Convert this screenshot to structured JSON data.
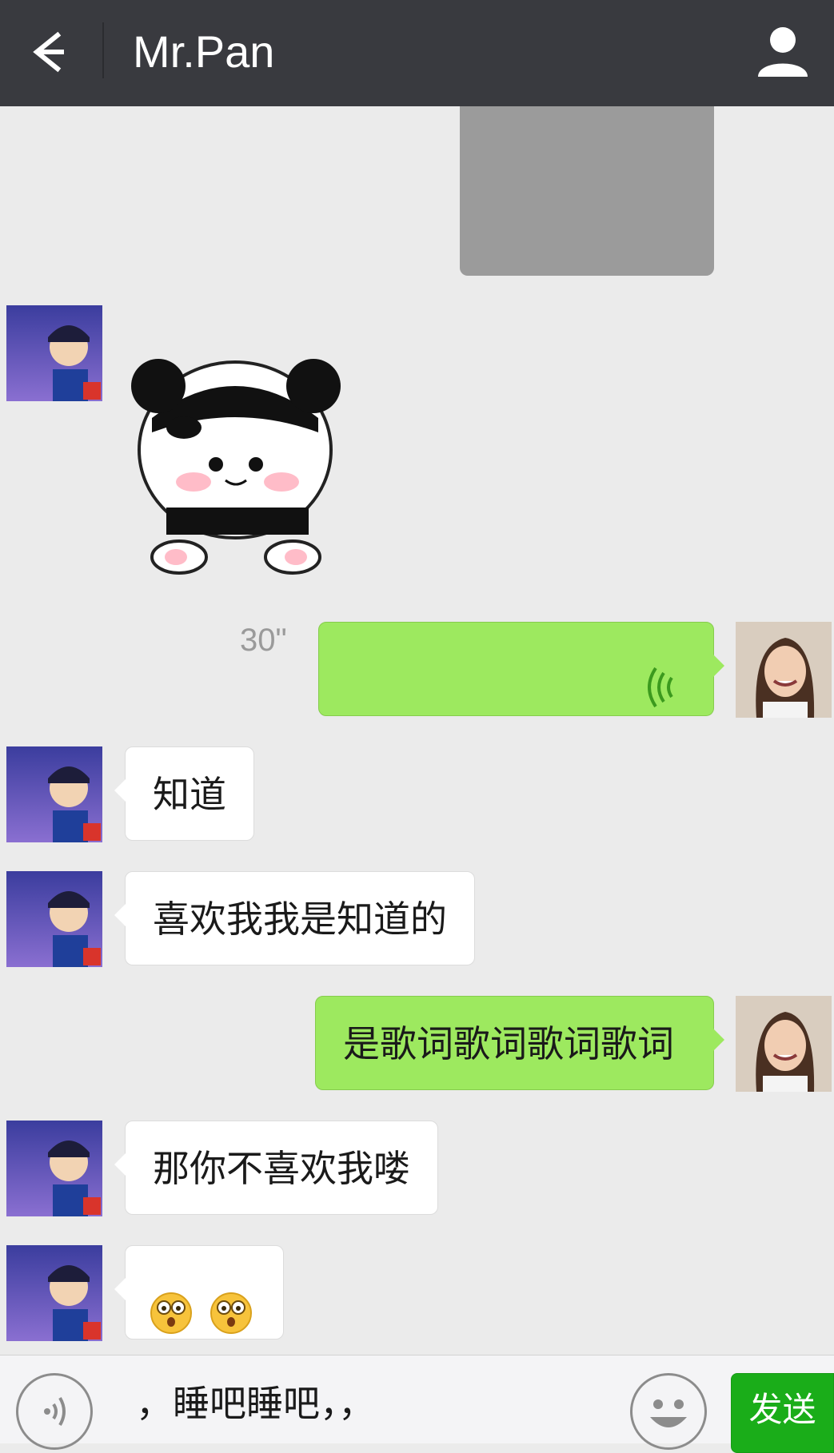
{
  "header": {
    "title": "Mr.Pan"
  },
  "messages": {
    "voice_duration": "30\"",
    "m1": "知道",
    "m2": "喜欢我我是知道的",
    "m3": "是歌词歌词歌词歌词",
    "m4": "那你不喜欢我喽"
  },
  "input": {
    "text": "，睡吧睡吧，，",
    "send_label": "发送"
  },
  "colors": {
    "header_bg": "#393a3f",
    "chat_bg": "#ebebeb",
    "outgoing_bubble": "#9de95f",
    "incoming_bubble": "#ffffff",
    "send_button": "#1aad19"
  },
  "icons": [
    "back-arrow-icon",
    "profile-icon",
    "voice-wave-icon",
    "voice-toggle-icon",
    "emoji-icon",
    "surprised-emoji-icon"
  ]
}
